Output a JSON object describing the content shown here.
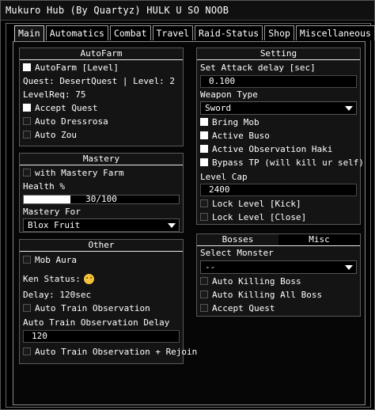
{
  "window": {
    "title": "Mukuro Hub (By Quartyz) HULK U SO NOOB"
  },
  "tabs": [
    "Main",
    "Automatics",
    "Combat",
    "Travel",
    "Raid-Status",
    "Shop",
    "Miscellaneous"
  ],
  "autofarm": {
    "title": "AutoFarm",
    "autofarm_level": {
      "label": "AutoFarm [Level]",
      "checked": true
    },
    "quest_info": "Quest: DesertQuest | Level: 2",
    "level_req": "LevelReq: 75",
    "accept_quest": {
      "label": "Accept Quest",
      "checked": true
    },
    "auto_dressrosa": {
      "label": "Auto Dressrosa",
      "checked": false
    },
    "auto_zou": {
      "label": "Auto Zou",
      "checked": false
    }
  },
  "mastery": {
    "title": "Mastery",
    "with_mastery_farm": {
      "label": "with Mastery Farm",
      "checked": false
    },
    "health_label": "Health %",
    "health_value": 30,
    "health_text": "30/100",
    "mastery_for_label": "Mastery For",
    "mastery_for_value": "Blox Fruit"
  },
  "other": {
    "title": "Other",
    "mob_aura": {
      "label": "Mob Aura",
      "checked": false
    },
    "ken_status": "Ken Status:",
    "delay": "Delay: 120sec",
    "auto_train_observation": {
      "label": "Auto Train Observation",
      "checked": false
    },
    "observation_delay_label": "Auto Train Observation Delay",
    "observation_delay_value": "120",
    "auto_train_rejoin": {
      "label": "Auto Train Observation + Rejoin",
      "checked": false
    }
  },
  "setting": {
    "title": "Setting",
    "attack_delay_label": "Set Attack delay [sec]",
    "attack_delay_value": "0.100",
    "weapon_type_label": "Weapon Type",
    "weapon_type_value": "Sword",
    "bring_mob": {
      "label": "Bring Mob",
      "checked": true
    },
    "active_buso": {
      "label": "Active Buso",
      "checked": true
    },
    "active_observation": {
      "label": "Active Observation Haki",
      "checked": true
    },
    "bypass_tp": {
      "label": "Bypass TP (will kill ur self)",
      "checked": true
    },
    "level_cap_label": "Level Cap",
    "level_cap_value": "2400",
    "lock_level_kick": {
      "label": "Lock Level [Kick]",
      "checked": false
    },
    "lock_level_close": {
      "label": "Lock Level [Close]",
      "checked": false
    }
  },
  "bosses": {
    "tabs": [
      "Bosses",
      "Misc"
    ],
    "select_monster_label": "Select Monster",
    "select_monster_value": "--",
    "auto_killing_boss": {
      "label": "Auto Killing Boss",
      "checked": false
    },
    "auto_killing_all": {
      "label": "Auto Killing All Boss",
      "checked": false
    },
    "accept_quest": {
      "label": "Accept Quest",
      "checked": false
    }
  },
  "colors": {
    "background": "#000000",
    "panel": "#141414",
    "text": "#ffffff",
    "checked": "#ffffff"
  }
}
